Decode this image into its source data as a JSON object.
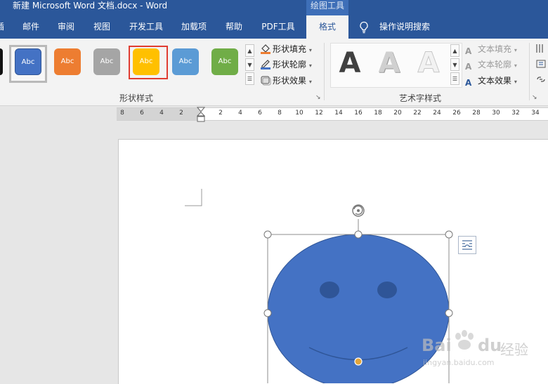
{
  "window": {
    "title": "新建 Microsoft Word 文档.docx  -  Word",
    "context_group": "绘图工具"
  },
  "tabs": [
    {
      "label": "邮件"
    },
    {
      "label": "审阅"
    },
    {
      "label": "视图"
    },
    {
      "label": "开发工具"
    },
    {
      "label": "加载项"
    },
    {
      "label": "帮助"
    },
    {
      "label": "PDF工具"
    },
    {
      "label": "格式",
      "active": true
    }
  ],
  "tell_me": {
    "label": "操作说明搜索",
    "icon": "lightbulb-icon"
  },
  "shape_styles": {
    "group_label": "形状样式",
    "gallery": [
      {
        "label": "Abc",
        "color": "#4472c4"
      },
      {
        "label": "Abc",
        "color": "#ed7d31"
      },
      {
        "label": "Abc",
        "color": "#a5a5a5"
      },
      {
        "label": "Abc",
        "color": "#ffc000"
      },
      {
        "label": "Abc",
        "color": "#5b9bd5"
      },
      {
        "label": "Abc",
        "color": "#70ad47"
      }
    ],
    "fill": "形状填充",
    "outline": "形状轮廓",
    "effects": "形状效果"
  },
  "wordart_styles": {
    "group_label": "艺术字样式",
    "sample": "A",
    "text_fill": "文本填充",
    "text_outline": "文本轮廓",
    "text_effects": "文本效果"
  },
  "ruler": {
    "left_ticks": [
      "8",
      "6",
      "4",
      "2"
    ],
    "right_ticks": [
      "2",
      "4",
      "6",
      "8",
      "10",
      "12",
      "14",
      "16",
      "18",
      "20",
      "22",
      "24",
      "26",
      "28",
      "30",
      "32",
      "34"
    ]
  },
  "shape": {
    "fill": "#4472c4",
    "eye_color": "#2f5597",
    "handle_color": "#e3a53a"
  },
  "watermark": {
    "brand": "Bai",
    "brand2": "du",
    "brand_cn": "经验",
    "url": "jingyan.baidu.com"
  },
  "colors": {
    "accent": "#2b579a",
    "highlight": "#e03c31"
  }
}
